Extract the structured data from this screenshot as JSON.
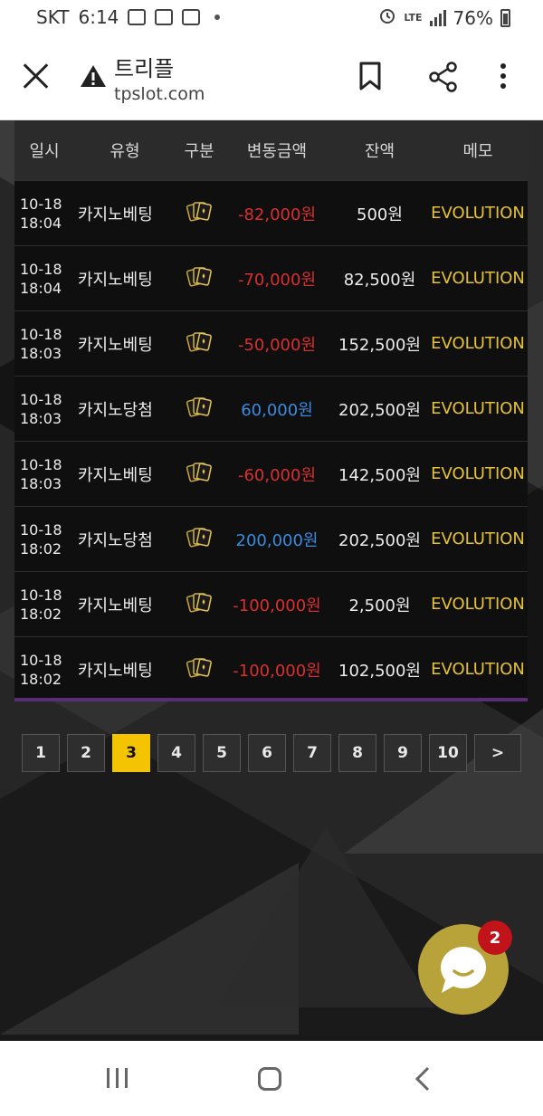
{
  "status_bar": {
    "carrier": "SKT",
    "time": "6:14",
    "network": "LTE",
    "battery": "76%"
  },
  "toolbar": {
    "title": "트리플",
    "url": "tpslot.com"
  },
  "table": {
    "headers": [
      "일시",
      "유형",
      "구분",
      "변동금액",
      "잔액",
      "메모"
    ],
    "rows": [
      {
        "date": "10-18",
        "time": "18:04",
        "type": "카지노베팅",
        "amount": "-82,000원",
        "balance": "500원",
        "memo": "EVOLUTION",
        "sign": "neg"
      },
      {
        "date": "10-18",
        "time": "18:04",
        "type": "카지노베팅",
        "amount": "-70,000원",
        "balance": "82,500원",
        "memo": "EVOLUTION",
        "sign": "neg"
      },
      {
        "date": "10-18",
        "time": "18:03",
        "type": "카지노베팅",
        "amount": "-50,000원",
        "balance": "152,500원",
        "memo": "EVOLUTION",
        "sign": "neg"
      },
      {
        "date": "10-18",
        "time": "18:03",
        "type": "카지노당첨",
        "amount": "60,000원",
        "balance": "202,500원",
        "memo": "EVOLUTION",
        "sign": "pos"
      },
      {
        "date": "10-18",
        "time": "18:03",
        "type": "카지노베팅",
        "amount": "-60,000원",
        "balance": "142,500원",
        "memo": "EVOLUTION",
        "sign": "neg"
      },
      {
        "date": "10-18",
        "time": "18:02",
        "type": "카지노당첨",
        "amount": "200,000원",
        "balance": "202,500원",
        "memo": "EVOLUTION",
        "sign": "pos"
      },
      {
        "date": "10-18",
        "time": "18:02",
        "type": "카지노베팅",
        "amount": "-100,000원",
        "balance": "2,500원",
        "memo": "EVOLUTION",
        "sign": "neg"
      },
      {
        "date": "10-18",
        "time": "18:02",
        "type": "카지노베팅",
        "amount": "-100,000원",
        "balance": "102,500원",
        "memo": "EVOLUTION",
        "sign": "neg"
      }
    ]
  },
  "pagination": {
    "pages": [
      "1",
      "2",
      "3",
      "4",
      "5",
      "6",
      "7",
      "8",
      "9",
      "10"
    ],
    "current": "3",
    "next_label": ">"
  },
  "chat": {
    "badge_count": "2"
  },
  "colors": {
    "negative": "#d83030",
    "positive": "#3a8bdf",
    "memo": "#e6c13a",
    "active_page": "#f5c400",
    "badge": "#c0141a"
  },
  "icons": {
    "row_category": "casino-cards-icon",
    "chat": "chat-bubble-icon"
  }
}
